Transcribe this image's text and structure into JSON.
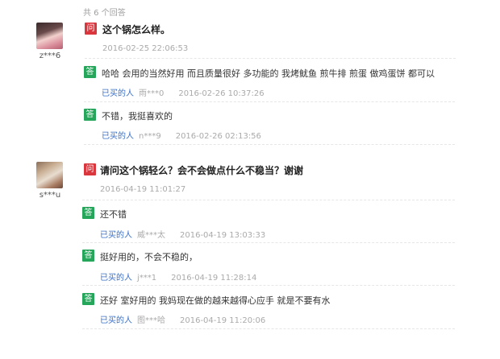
{
  "total_answers": "共 6 个回答",
  "badges": {
    "question": "问",
    "answer": "答"
  },
  "threads": [
    {
      "user": "z***6",
      "question": "这个锅怎么样。",
      "date": "2016-02-25 22:06:53",
      "answers": [
        {
          "text": "哈哈 会用的当然好用 而且质量很好 多功能的 我烤鱿鱼 煎牛排 煎蛋 做鸡蛋饼 都可以",
          "buyer_label": "已买的人",
          "buyer": "雨***0",
          "date": "2016-02-26 10:37:26"
        },
        {
          "text": "不错，我挺喜欢的",
          "buyer_label": "已买的人",
          "buyer": "n***9",
          "date": "2016-02-26 02:13:56"
        }
      ]
    },
    {
      "user": "s***u",
      "question": "请问这个锅轻么？会不会做点什么不稳当？谢谢",
      "date": "2016-04-19 11:01:27",
      "answers": [
        {
          "text": "还不错",
          "buyer_label": "已买的人",
          "buyer": "威***太",
          "date": "2016-04-19 13:03:33"
        },
        {
          "text": "挺好用的，不会不稳的，",
          "buyer_label": "已买的人",
          "buyer": "j***1",
          "date": "2016-04-19 11:28:14"
        },
        {
          "text": "还好 室好用的 我妈现在做的越来越得心应手 就是不要有水",
          "buyer_label": "已买的人",
          "buyer": "图***哈",
          "date": "2016-04-19 11:20:06"
        }
      ]
    }
  ]
}
